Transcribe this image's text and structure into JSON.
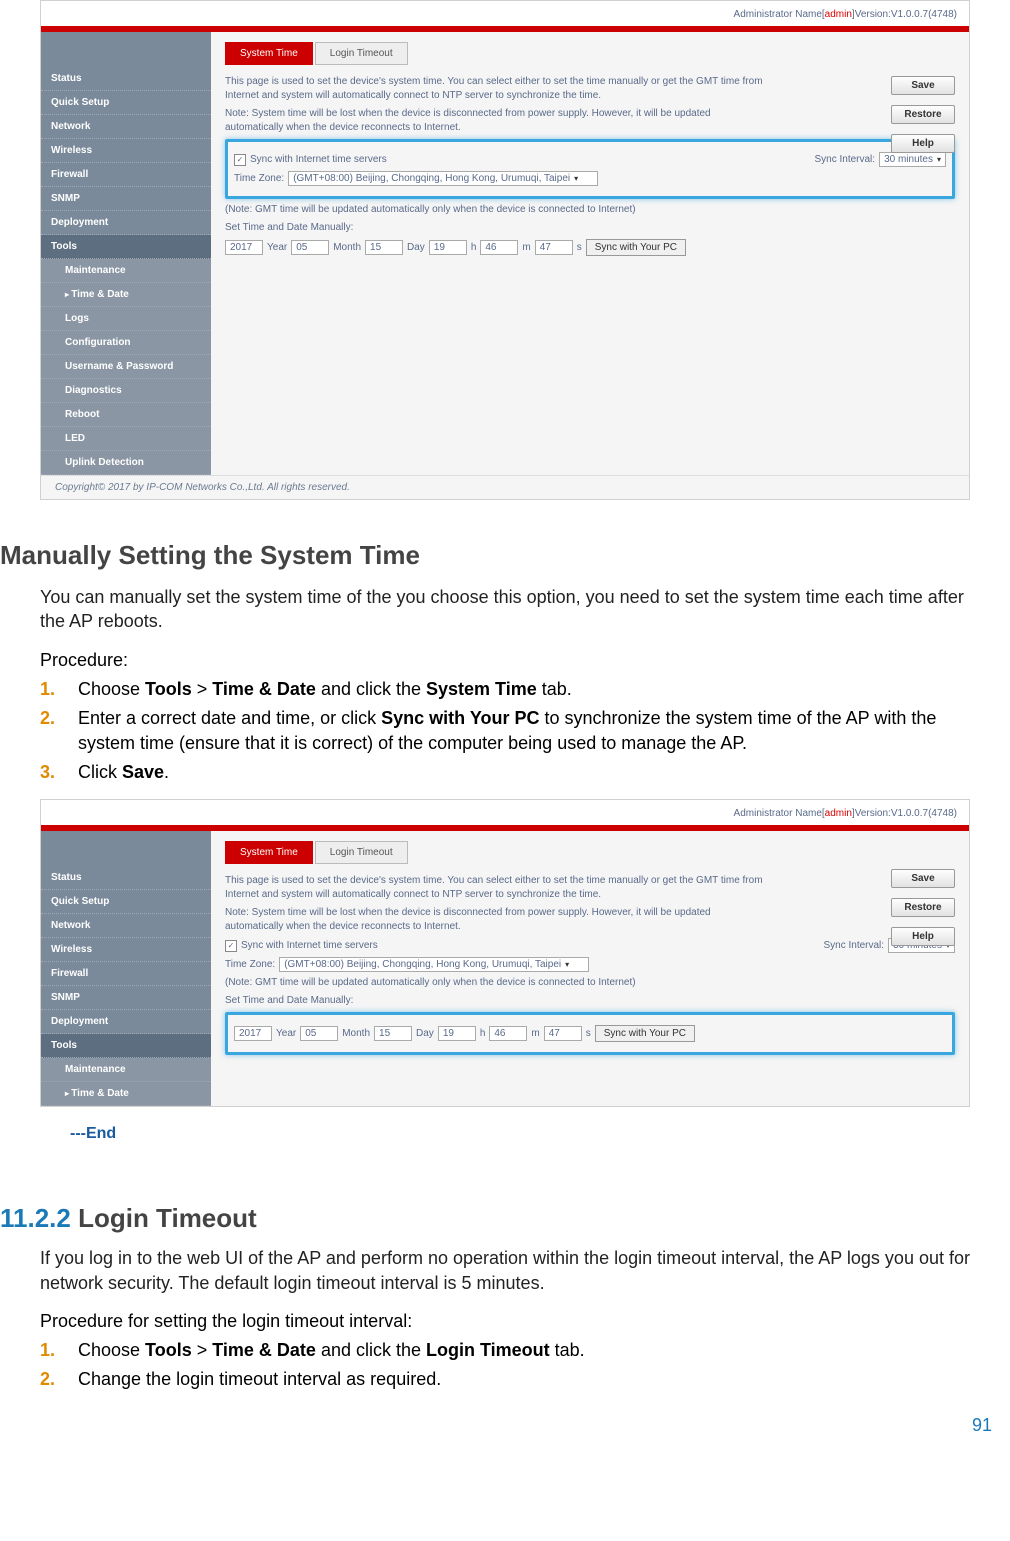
{
  "page_number": "91",
  "screenshot1": {
    "header_prefix": "Administrator Name[",
    "header_admin": "admin",
    "header_suffix": "]Version:V1.0.0.7(4748)",
    "side_main": [
      "Status",
      "Quick Setup",
      "Network",
      "Wireless",
      "Firewall",
      "SNMP",
      "Deployment"
    ],
    "side_tools": "Tools",
    "side_subs": [
      "Maintenance",
      "Time & Date",
      "Logs",
      "Configuration",
      "Username & Password",
      "Diagnostics",
      "Reboot",
      "LED",
      "Uplink Detection"
    ],
    "tab_active": "System Time",
    "tab_inactive": "Login Timeout",
    "desc1": "This page is used to set the device's system time. You can select either to set the time manually or get the GMT time from Internet and system will automatically connect to NTP server to synchronize the time.",
    "desc2": "Note: System time will be lost when the device is disconnected from power supply. However, it will be updated automatically when the device reconnects to Internet.",
    "sync_label": "Sync with Internet time servers",
    "sync_interval_label": "Sync Interval:",
    "sync_interval_value": "30 minutes",
    "tz_label": "Time Zone:",
    "tz_value": "(GMT+08:00) Beijing, Chongqing, Hong Kong, Urumuqi, Taipei",
    "note_gmt": "(Note: GMT time will be updated automatically only when the device is connected to Internet)",
    "manual_label": "Set Time and Date Manually:",
    "year": "2017",
    "year_l": "Year",
    "month": "05",
    "month_l": "Month",
    "day": "15",
    "day_l": "Day",
    "hour": "19",
    "hour_l": "h",
    "min": "46",
    "min_l": "m",
    "sec": "47",
    "sec_l": "s",
    "sync_pc": "Sync with Your PC",
    "btn_save": "Save",
    "btn_restore": "Restore",
    "btn_help": "Help",
    "copyright": "Copyright© 2017 by IP-COM Networks Co.,Ltd. All rights reserved."
  },
  "doc": {
    "h_manual": "Manually Setting the System Time",
    "p_manual": "You can manually set the system time of the you choose this option, you need to set the system time each time after the AP reboots.",
    "procedure": "Procedure:",
    "s1_a": "Choose ",
    "s1_b": "Tools",
    "s1_c": " > ",
    "s1_d": "Time & Date",
    "s1_e": " and click the ",
    "s1_f": "System Time",
    "s1_g": " tab.",
    "s2_a": "Enter a correct date and time, or click ",
    "s2_b": "Sync with Your PC",
    "s2_c": " to synchronize the system time of the AP with the system time (ensure that it is correct) of the computer being used to manage the AP.",
    "s3_a": "Click ",
    "s3_b": "Save",
    "s3_c": ".",
    "end": "---End",
    "sec_num": "11.2.2",
    "sec_title": " Login Timeout",
    "p_login": "If you log in to the web UI of the AP and perform no operation within the login timeout interval, the AP logs you out for network security. The default login timeout interval is 5 minutes.",
    "procedure2": "Procedure for setting the login timeout interval:",
    "l1_a": "Choose ",
    "l1_b": "Tools",
    "l1_c": " > ",
    "l1_d": "Time & Date",
    "l1_e": " and click the ",
    "l1_f": "Login Timeout",
    "l1_g": " tab.",
    "l2": "Change the login timeout interval as required."
  },
  "screenshot2": {
    "side_main": [
      "Status",
      "Quick Setup",
      "Network",
      "Wireless",
      "Firewall",
      "SNMP",
      "Deployment"
    ],
    "side_tools": "Tools",
    "side_subs": [
      "Maintenance",
      "Time & Date"
    ]
  }
}
